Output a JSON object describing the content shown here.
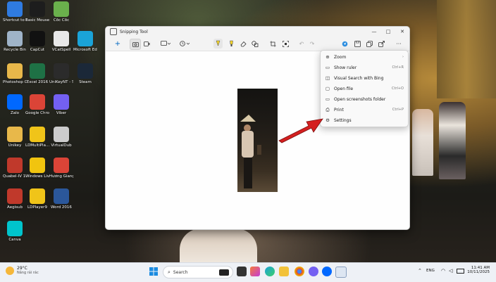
{
  "desktop": {
    "icons": [
      {
        "label": "Shortcut to Desktop (...",
        "color": "#2f7be0"
      },
      {
        "label": "Basic Mouse Skills",
        "color": "#1d1d1d"
      },
      {
        "label": "Cốc Cốc",
        "color": "#6ab04c"
      },
      {
        "label": "Recycle Bin",
        "color": "#9fb4c8"
      },
      {
        "label": "CapCut",
        "color": "#111111"
      },
      {
        "label": "VCatSpell",
        "color": "#e8e8e8"
      },
      {
        "label": "Microsoft Edge",
        "color": "#1aa3d8"
      },
      {
        "label": "Photoshop CS6 Portab...",
        "color": "#e8b84a"
      },
      {
        "label": "Excel 2016",
        "color": "#1e7145"
      },
      {
        "label": "UniKeyNT - Shortcut",
        "color": "#2b2b2b"
      },
      {
        "label": "Steam",
        "color": "#1b2838"
      },
      {
        "label": "Zalo",
        "color": "#0068ff"
      },
      {
        "label": "Google Chrome",
        "color": "#db4437"
      },
      {
        "label": "Viber",
        "color": "#7360f2"
      },
      {
        "label": "Unikey",
        "color": "#e8b84a"
      },
      {
        "label": "LDMultiPla...",
        "color": "#f0c419"
      },
      {
        "label": "VirtualDub",
        "color": "#cccccc"
      },
      {
        "label": "Quabel-IV 1.19.1",
        "color": "#c0392b"
      },
      {
        "label": "Windows Live Mail",
        "color": "#f1c40f"
      },
      {
        "label": "Hương Giang - Chrome",
        "color": "#db4437"
      },
      {
        "label": "Aegisub",
        "color": "#c0392b"
      },
      {
        "label": "LDPlayer9",
        "color": "#f0c419"
      },
      {
        "label": "Word 2016",
        "color": "#2b579a"
      },
      {
        "label": "Canva",
        "color": "#00c4cc"
      }
    ]
  },
  "window": {
    "title": "Snipping Tool",
    "minimize": "—",
    "maximize": "□",
    "close": "✕"
  },
  "toolbar": {
    "new": "+",
    "more": "···"
  },
  "menu": {
    "items": [
      {
        "label": "Zoom",
        "shortcut": "›",
        "icon": "zoom-icon",
        "glyph": "⊕"
      },
      {
        "label": "Show ruler",
        "shortcut": "Ctrl+R",
        "icon": "ruler-icon",
        "glyph": "▭"
      },
      {
        "label": "Visual Search with Bing",
        "shortcut": "",
        "icon": "visual-search-icon",
        "glyph": "◫"
      },
      {
        "label": "Open file",
        "shortcut": "Ctrl+O",
        "icon": "open-file-icon",
        "glyph": "▢"
      },
      {
        "label": "Open screenshots folder",
        "shortcut": "",
        "icon": "folder-icon",
        "glyph": "▭"
      },
      {
        "label": "Print",
        "shortcut": "Ctrl+P",
        "icon": "print-icon",
        "glyph": "⎙"
      },
      {
        "label": "Settings",
        "shortcut": "",
        "icon": "gear-icon",
        "glyph": "⚙"
      }
    ]
  },
  "taskbar": {
    "weather_temp": "29°C",
    "weather_desc": "Nắng rải rác",
    "search_placeholder": "Search",
    "language": "ENG",
    "time": "11:41 AM",
    "date": "10/11/2025"
  },
  "colors": {
    "accent": "#0067c0",
    "arrow": "#d42020"
  }
}
